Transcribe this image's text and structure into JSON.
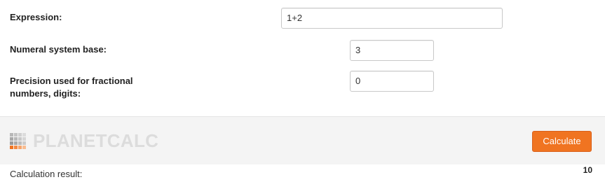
{
  "form": {
    "expression": {
      "label": "Expression:",
      "value": "1+2"
    },
    "base": {
      "label": "Numeral system base:",
      "value": "3"
    },
    "precision": {
      "label_line1": "Precision used for fractional",
      "label_line2": "numbers, digits:",
      "value": "0"
    }
  },
  "footer": {
    "logo_text": "PLANETCALC",
    "logo_icon": "planetcalc-grid-icon",
    "button_label": "Calculate",
    "accent_color": "#f07421"
  },
  "result": {
    "label": "Calculation result:",
    "value": "10"
  }
}
